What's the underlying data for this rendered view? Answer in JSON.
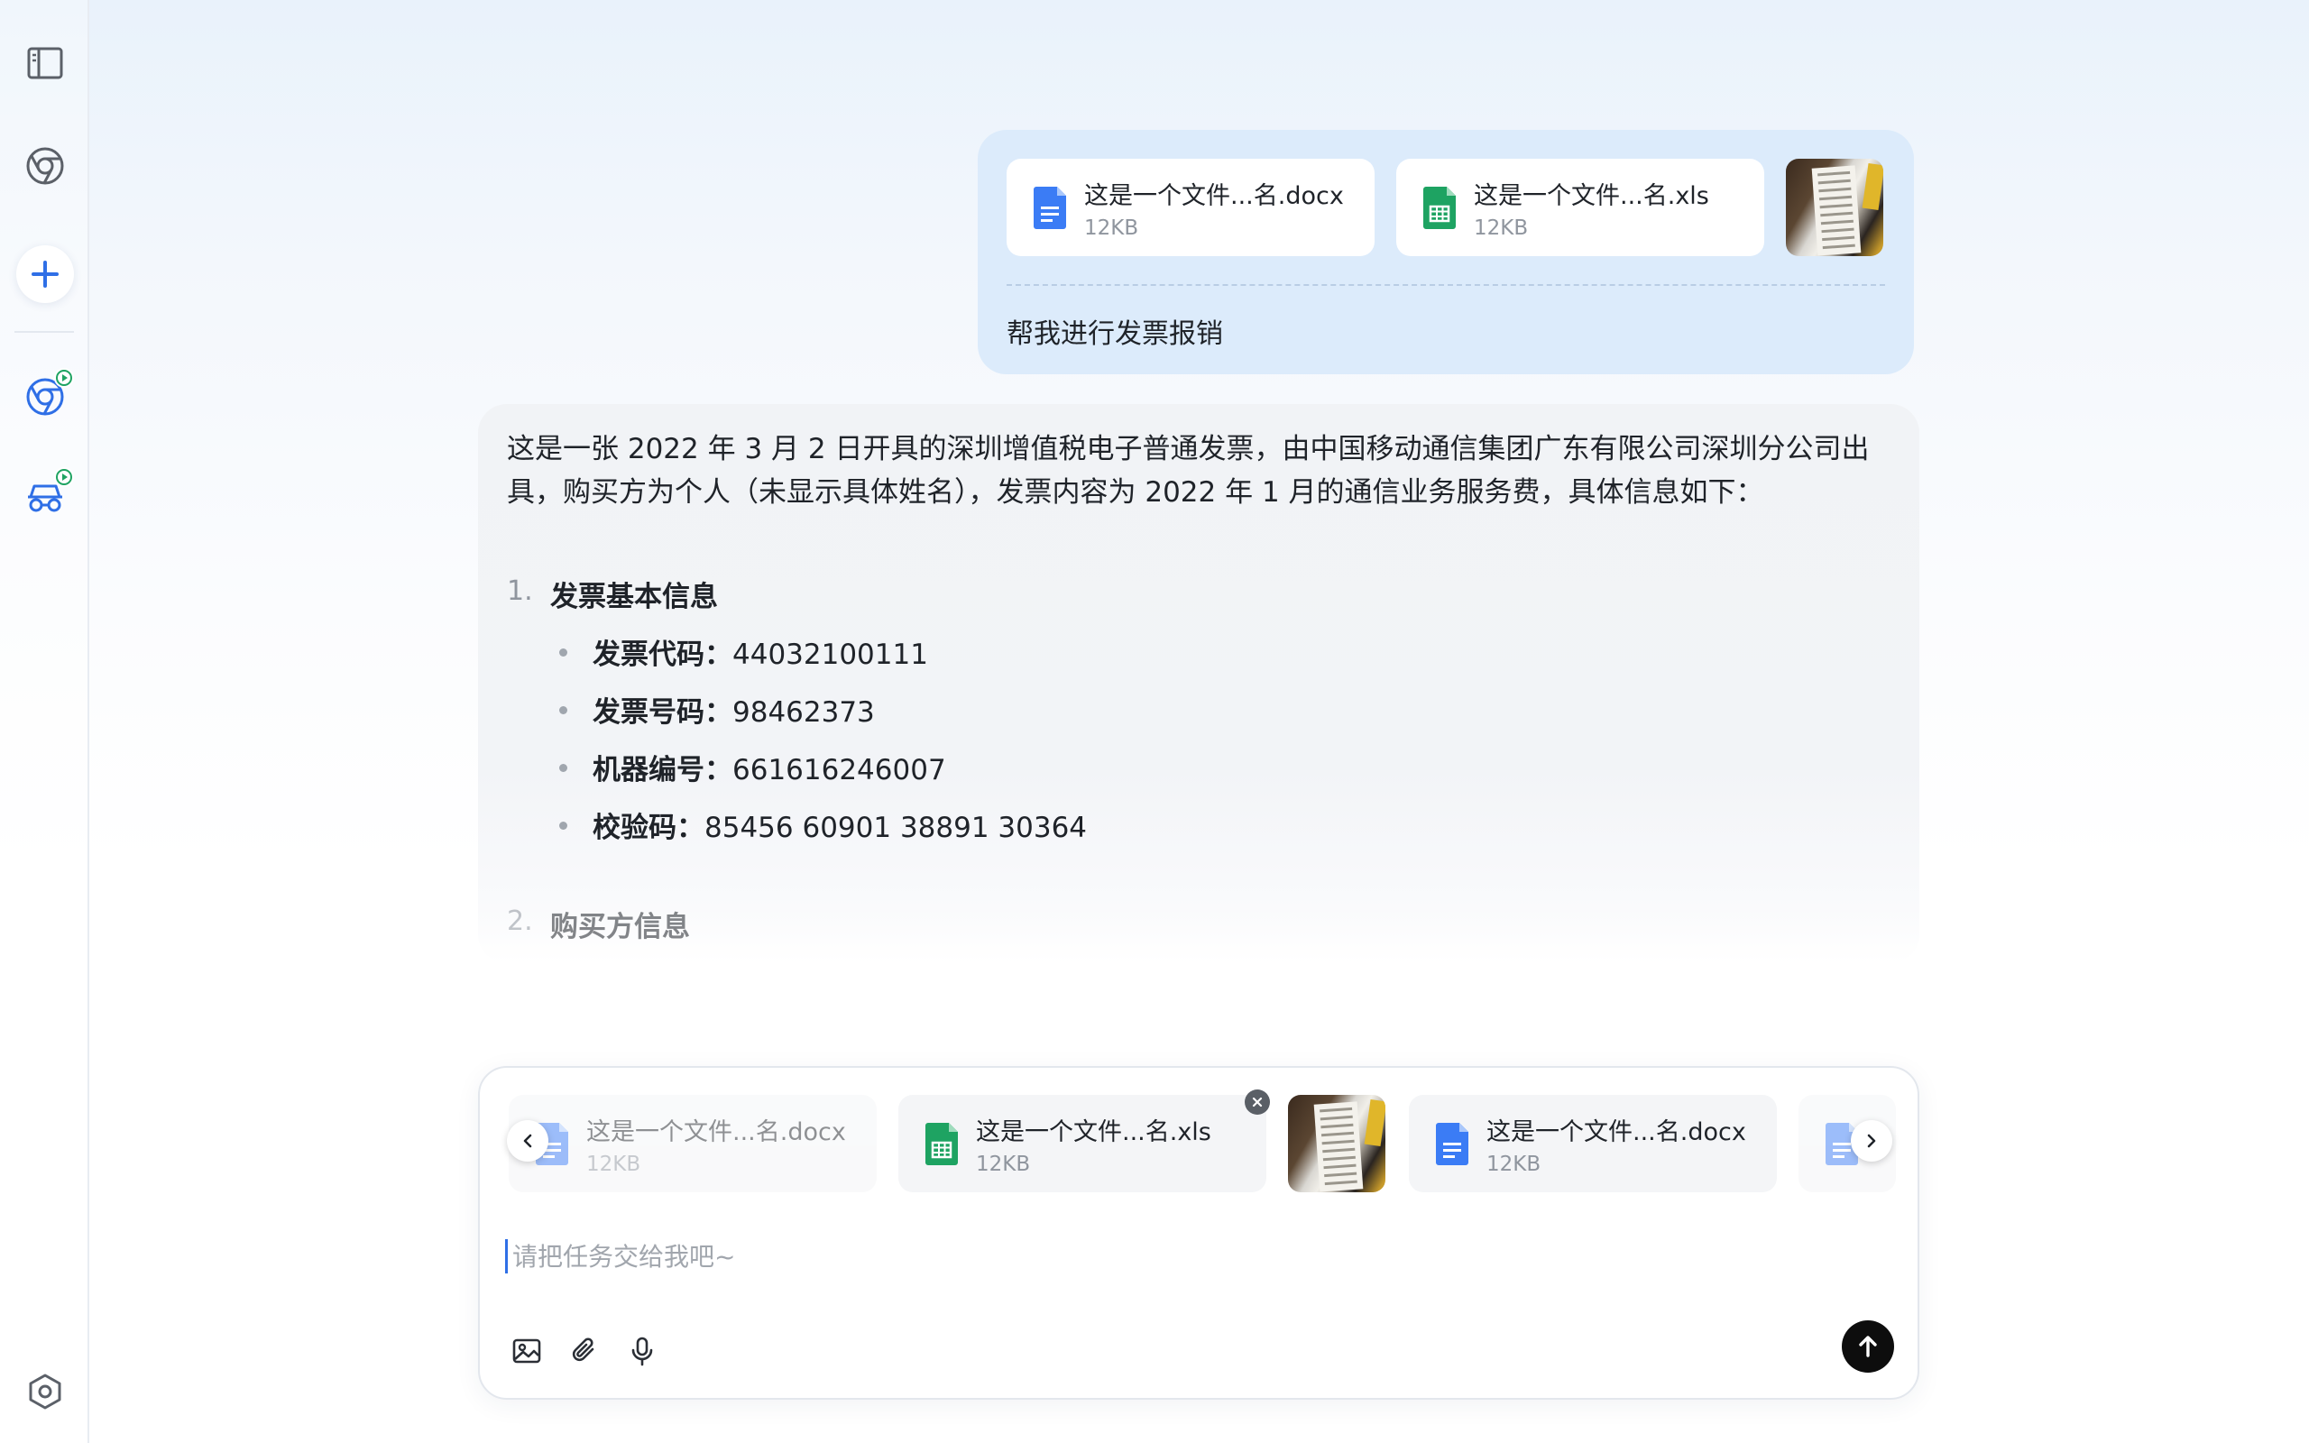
{
  "sidebar": {
    "items": [
      {
        "icon": "panel-toggle-icon"
      },
      {
        "icon": "browser-icon"
      },
      {
        "icon": "plus-icon"
      },
      {
        "icon": "browser-agent-icon"
      },
      {
        "icon": "car-agent-icon"
      }
    ],
    "settings_icon": "settings-hexagon-icon"
  },
  "user_message": {
    "attachments": [
      {
        "name": "这是一个文件...名.docx",
        "size": "12KB",
        "type": "docx"
      },
      {
        "name": "这是一个文件...名.xls",
        "size": "12KB",
        "type": "xls"
      },
      {
        "type": "image"
      }
    ],
    "text": "帮我进行发票报销"
  },
  "assistant_message": {
    "intro": "这是一张 2022 年 3 月 2 日开具的深圳增值税电子普通发票，由中国移动通信集团广东有限公司深圳分公司出具，购买方为个人（未显示具体姓名），发票内容为 2022 年 1 月的通信业务服务费，具体信息如下：",
    "sections": [
      {
        "num": "1.",
        "title": "发票基本信息",
        "items": [
          {
            "label": "发票代码：",
            "value": "44032100111"
          },
          {
            "label": "发票号码：",
            "value": "98462373"
          },
          {
            "label": "机器编号：",
            "value": "661616246007"
          },
          {
            "label": "校验码：",
            "value": "85456 60901 38891 30364"
          }
        ]
      },
      {
        "num": "2.",
        "title": "购买方信息"
      }
    ]
  },
  "composer": {
    "attachments": [
      {
        "name": "这是一个文件...名.docx",
        "size": "12KB",
        "type": "docx"
      },
      {
        "name": "这是一个文件...名.xls",
        "size": "12KB",
        "type": "xls"
      },
      {
        "type": "image"
      },
      {
        "name": "这是一个文件...名.docx",
        "size": "12KB",
        "type": "docx"
      },
      {
        "type": "docx"
      }
    ],
    "placeholder": "请把任务交给我吧~",
    "tools": [
      "image-upload-icon",
      "paperclip-icon",
      "microphone-icon"
    ],
    "send_icon": "arrow-up-icon"
  },
  "colors": {
    "accent": "#2f6fe6",
    "docx": "#3b7cf5",
    "xls": "#1ea362",
    "user_bubble": "#dcebfb",
    "send_button": "#0d0d0d"
  }
}
